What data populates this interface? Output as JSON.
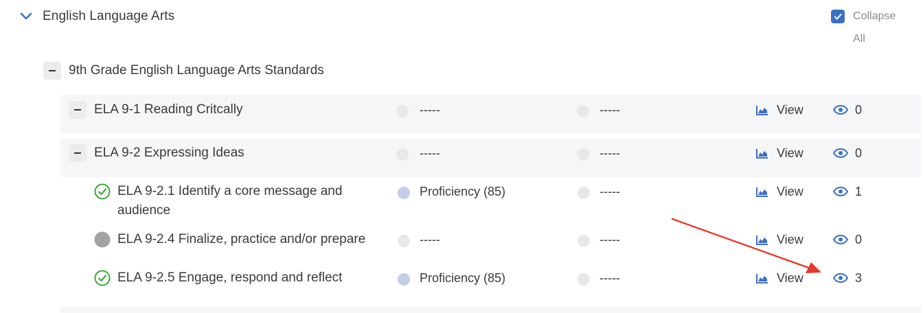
{
  "section": {
    "title": "English Language Arts"
  },
  "collapse_all": {
    "label_line1": "Collapse",
    "label_line2": "All",
    "checked": true
  },
  "group": {
    "title": "9th Grade English Language Arts Standards"
  },
  "rows": [
    {
      "name": "ELA 9-1 Reading Critcally",
      "col1": "-----",
      "col2": "-----",
      "view": "View",
      "views": "0"
    },
    {
      "name": "ELA 9-2 Expressing Ideas",
      "col1": "-----",
      "col2": "-----",
      "view": "View",
      "views": "0"
    },
    {
      "name_line1": "ELA 9-2.1 Identify a core message and",
      "name_line2": "audience",
      "status": "complete",
      "col1": "Proficiency (85)",
      "col2": "-----",
      "view": "View",
      "views": "1"
    },
    {
      "name": "ELA 9-2.4 Finalize, practice and/or prepare",
      "status": "not-started",
      "col1": "-----",
      "col2": "-----",
      "view": "View",
      "views": "0"
    },
    {
      "name": "ELA 9-2.5 Engage, respond and reflect",
      "status": "complete",
      "col1": "Proficiency (85)",
      "col2": "-----",
      "view": "View",
      "views": "3"
    }
  ],
  "colors": {
    "accent": "#3c6fc4",
    "success": "#3aa935",
    "annotation_arrow": "#e8382a"
  },
  "icons": [
    "chevron-down-icon",
    "checkbox-checked-icon",
    "collapse-minus-icon",
    "area-chart-icon",
    "eye-icon",
    "check-circle-icon",
    "gray-circle-icon"
  ]
}
